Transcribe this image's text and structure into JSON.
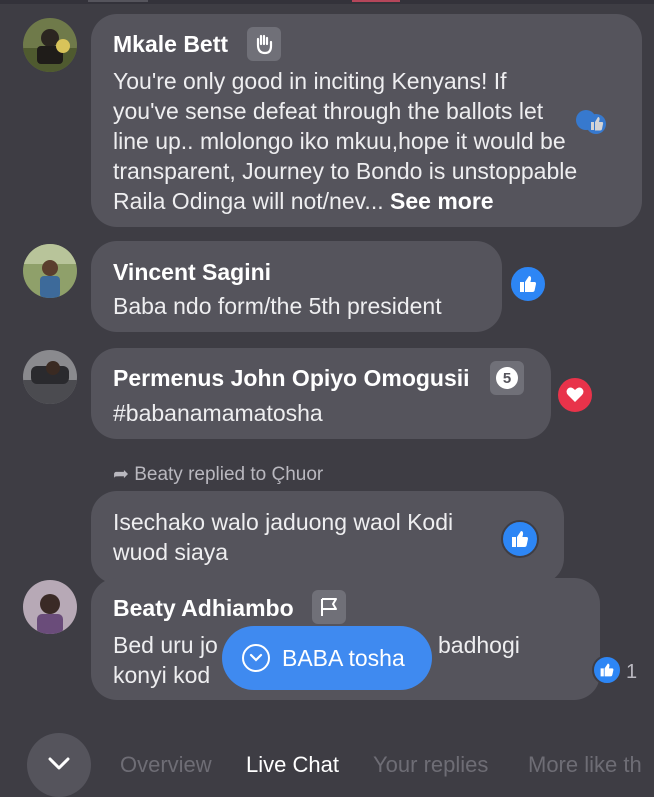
{
  "comments": [
    {
      "author": "Mkale Bett",
      "badge_icon": "wave-icon",
      "lines": [
        "You're only good in inciting Kenyans! If",
        "you've sense defeat through the ballots let",
        "line up.. mlolongo iko mkuu,hope it would be",
        "transparent, Journey to Bondo is unstoppable",
        "Raila Odinga will not/nev... "
      ],
      "see_more": "See more"
    },
    {
      "author": "Vincent Sagini",
      "lines": [
        "Baba ndo form/the 5th president"
      ],
      "reaction": "like-icon"
    },
    {
      "author": "Permenus John Opiyo Omogusii",
      "badge_text": "5",
      "lines": [
        "#babanamamatosha"
      ],
      "reaction": "love-icon"
    },
    {
      "replied_note": "Beaty replied to Çhuor",
      "lines": [
        "Isechako walo jaduong waol Kodi",
        "wuod siaya"
      ],
      "reaction": "like-icon"
    },
    {
      "author": "Beaty Adhiambo",
      "badge_icon": "flag-icon",
      "lines": [
        "Bed uru jo",
        "konyi kod"
      ],
      "hidden_tail": "badhogi",
      "reaction": "like-icon",
      "reaction_count": "1"
    }
  ],
  "new_comment_pill": {
    "label": "BABA tosha",
    "icon": "chevron-down-icon"
  },
  "tabs": [
    "Overview",
    "Live Chat",
    "Your replies",
    "More like th"
  ],
  "active_tab": "Live Chat",
  "colors": {
    "background": "#3e3d44",
    "bubble": "#55545c",
    "accent": "#3f8af0",
    "love": "#e8334a"
  }
}
